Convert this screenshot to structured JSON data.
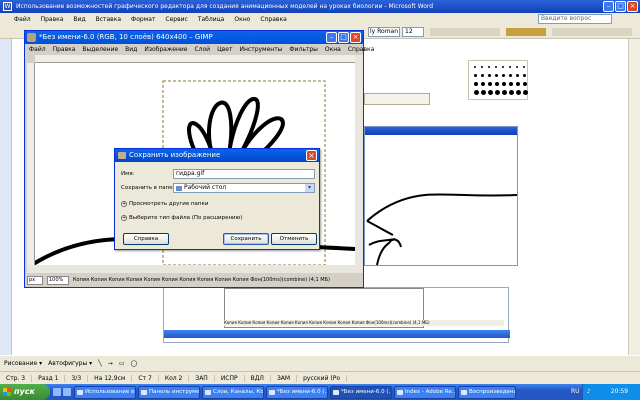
{
  "word": {
    "title": "Использование возможностей графического редактора для создания анимационных моделей на уроках биологии - Microsoft Word",
    "menu": [
      "Файл",
      "Правка",
      "Вид",
      "Вставка",
      "Формат",
      "Сервис",
      "Таблица",
      "Окно",
      "Справка"
    ],
    "help_placeholder": "Введите вопрос",
    "font_name": "ly Roman",
    "font_size": "12",
    "drawbar": {
      "draw": "Рисование ▾",
      "autoshapes": "Автофигуры ▾"
    },
    "status": [
      "Стр. 3",
      "Разд 1",
      "3/3",
      "На 12,9см",
      "Ст 7",
      "Кол 2",
      "ЗАП",
      "ИСПР",
      "ВДЛ",
      "ЗАМ",
      "русский (Ро"
    ]
  },
  "gimp": {
    "title": "*Без имени-6.0 (RGB, 10 слоёв) 640x400 – GIMP",
    "menu": [
      "Файл",
      "Правка",
      "Выделение",
      "Вид",
      "Изображение",
      "Слой",
      "Цвет",
      "Инструменты",
      "Фильтры",
      "Окна",
      "Справка"
    ],
    "unit": "px",
    "zoom": "100%",
    "status_message": "Копия Копия Копия Копия Копия Копия Копия Копия Копия Копия Фон(100ms)(combine) (4,1 МБ)"
  },
  "save_dialog": {
    "title": "Сохранить изображение",
    "name_label": "Имя:",
    "name_value": "гидра.gif",
    "folder_label": "Сохранить в папке:",
    "folder_value": "Рабочий стол",
    "browse_label": "Просмотреть другие папки",
    "filetype_label": "Выберите тип файла (По расширению)",
    "help_btn": "Справка",
    "save_btn": "Сохранить",
    "cancel_btn": "Отменить"
  },
  "taskbar": {
    "start": "пуск",
    "tasks": [
      "Использование в...",
      "Панель инструме...",
      "Слои, Каналы, Ко...",
      "*Без имени-6.0 (...",
      "*Без имени-6.0 (...",
      "Index - Adobe Re...",
      "Воспроизведени..."
    ],
    "lang": "RU",
    "clock": "20:59"
  }
}
